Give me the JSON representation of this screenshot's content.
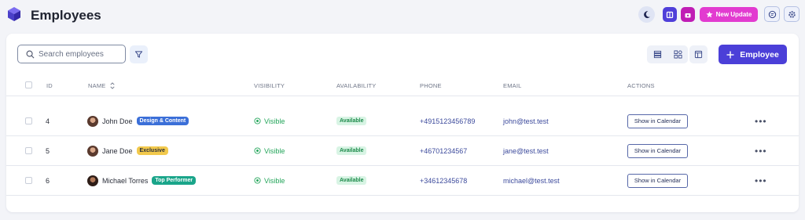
{
  "header": {
    "title": "Employees",
    "new_update_label": "New Update"
  },
  "toolbar": {
    "search_placeholder": "Search employees",
    "add_employee_label": "Employee"
  },
  "table": {
    "columns": [
      "ID",
      "NAME",
      "VISIBILITY",
      "AVAILABILITY",
      "PHONE",
      "EMAIL",
      "ACTIONS"
    ],
    "rows": [
      {
        "id": "4",
        "name": "John Doe",
        "tag": "Design & Content",
        "tag_color": "#3b6fd8",
        "visibility": "Visible",
        "availability": "Available",
        "phone": "+4915123456789",
        "email": "john@test.test",
        "action": "Show in Calendar"
      },
      {
        "id": "5",
        "name": "Jane Doe",
        "tag": "Exclusive",
        "tag_color": "#f2c94c",
        "visibility": "Visible",
        "availability": "Available",
        "phone": "+46701234567",
        "email": "jane@test.test",
        "action": "Show in Calendar"
      },
      {
        "id": "6",
        "name": "Michael Torres",
        "tag": "Top Performer",
        "tag_color": "#1aa58a",
        "visibility": "Visible",
        "availability": "Available",
        "phone": "+34612345678",
        "email": "michael@test.test",
        "action": "Show in Calendar"
      }
    ]
  },
  "colors": {
    "primary": "#4b3fd8",
    "new_update_bg": "#e23bd0",
    "visible_green": "#23a55a"
  },
  "icons": [
    "logo-cube-icon",
    "moon-icon",
    "book-icon",
    "gift-icon",
    "star-icon",
    "chat-icon",
    "gear-icon",
    "search-icon",
    "filter-icon",
    "list-view-icon",
    "grid-view-icon",
    "layout-icon",
    "plus-icon",
    "sort-icon",
    "eye-icon",
    "more-icon"
  ]
}
